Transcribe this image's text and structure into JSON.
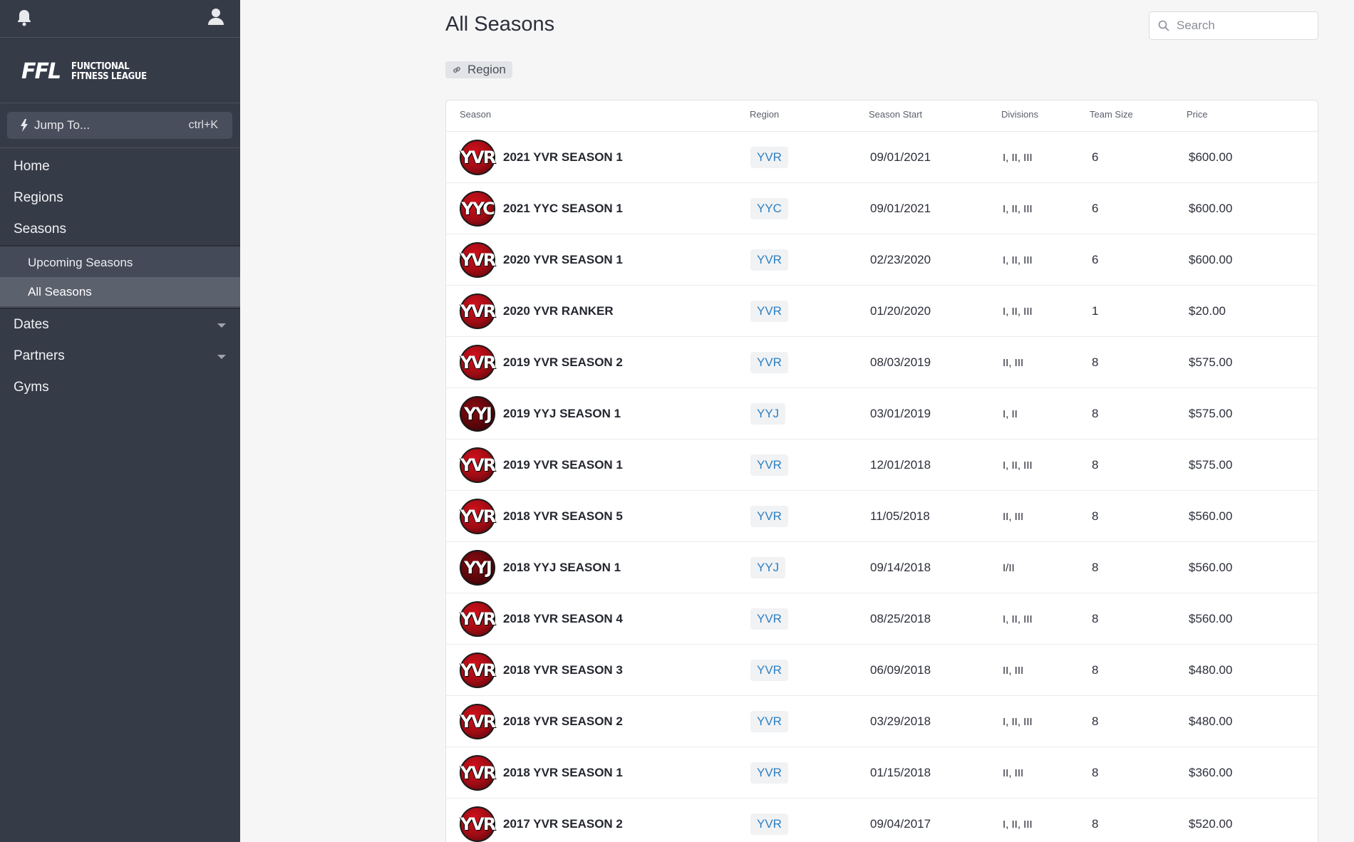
{
  "sidebar": {
    "logo": {
      "mark": "FFL",
      "line1": "FUNCTIONAL",
      "line2": "FITNESS LEAGUE"
    },
    "jump": {
      "label": "Jump To...",
      "shortcut": "ctrl+K"
    },
    "nav": [
      {
        "label": "Home"
      },
      {
        "label": "Regions"
      },
      {
        "label": "Seasons"
      }
    ],
    "subnav": [
      {
        "label": "Upcoming Seasons"
      },
      {
        "label": "All Seasons"
      }
    ],
    "nav2": [
      {
        "label": "Dates"
      },
      {
        "label": "Partners"
      },
      {
        "label": "Gyms"
      }
    ]
  },
  "main": {
    "title": "All Seasons",
    "search_placeholder": "Search",
    "filter_chip": "Region"
  },
  "table": {
    "headers": {
      "season": "Season",
      "region": "Region",
      "start": "Season Start",
      "divisions": "Divisions",
      "team_size": "Team Size",
      "price": "Price"
    },
    "rows": [
      {
        "avatar": "YVR",
        "season": "2021 YVR SEASON 1",
        "region": "YVR",
        "start": "09/01/2021",
        "divisions": "I, II, III",
        "team_size": "6",
        "price": "$600.00"
      },
      {
        "avatar": "YYC",
        "season": "2021 YYC SEASON 1",
        "region": "YYC",
        "start": "09/01/2021",
        "divisions": "I, II, III",
        "team_size": "6",
        "price": "$600.00"
      },
      {
        "avatar": "YVR",
        "season": "2020 YVR SEASON 1",
        "region": "YVR",
        "start": "02/23/2020",
        "divisions": "I, II, III",
        "team_size": "6",
        "price": "$600.00"
      },
      {
        "avatar": "YVR",
        "season": "2020 YVR RANKER",
        "region": "YVR",
        "start": "01/20/2020",
        "divisions": "I, II, III",
        "team_size": "1",
        "price": "$20.00"
      },
      {
        "avatar": "YVR",
        "season": "2019 YVR SEASON 2",
        "region": "YVR",
        "start": "08/03/2019",
        "divisions": "II, III",
        "team_size": "8",
        "price": "$575.00"
      },
      {
        "avatar": "YYJ",
        "season": "2019 YYJ SEASON 1",
        "region": "YYJ",
        "start": "03/01/2019",
        "divisions": "I, II",
        "team_size": "8",
        "price": "$575.00"
      },
      {
        "avatar": "YVR",
        "season": "2019 YVR SEASON 1",
        "region": "YVR",
        "start": "12/01/2018",
        "divisions": "I, II, III",
        "team_size": "8",
        "price": "$575.00"
      },
      {
        "avatar": "YVR",
        "season": "2018 YVR SEASON 5",
        "region": "YVR",
        "start": "11/05/2018",
        "divisions": "II, III",
        "team_size": "8",
        "price": "$560.00"
      },
      {
        "avatar": "YYJ",
        "season": "2018 YYJ SEASON 1",
        "region": "YYJ",
        "start": "09/14/2018",
        "divisions": "I/II",
        "team_size": "8",
        "price": "$560.00"
      },
      {
        "avatar": "YVR",
        "season": "2018 YVR SEASON 4",
        "region": "YVR",
        "start": "08/25/2018",
        "divisions": "I, II, III",
        "team_size": "8",
        "price": "$560.00"
      },
      {
        "avatar": "YVR",
        "season": "2018 YVR SEASON 3",
        "region": "YVR",
        "start": "06/09/2018",
        "divisions": "II, III",
        "team_size": "8",
        "price": "$480.00"
      },
      {
        "avatar": "YVR",
        "season": "2018 YVR SEASON 2",
        "region": "YVR",
        "start": "03/29/2018",
        "divisions": "I, II, III",
        "team_size": "8",
        "price": "$480.00"
      },
      {
        "avatar": "YVR",
        "season": "2018 YVR SEASON 1",
        "region": "YVR",
        "start": "01/15/2018",
        "divisions": "II, III",
        "team_size": "8",
        "price": "$360.00"
      },
      {
        "avatar": "YVR",
        "season": "2017 YVR SEASON 2",
        "region": "YVR",
        "start": "09/04/2017",
        "divisions": "I, II, III",
        "team_size": "8",
        "price": "$520.00"
      }
    ]
  },
  "colors": {
    "sidebar": "#363b48",
    "region_link": "#2d80c2",
    "avatar_red": "#c3101a"
  }
}
